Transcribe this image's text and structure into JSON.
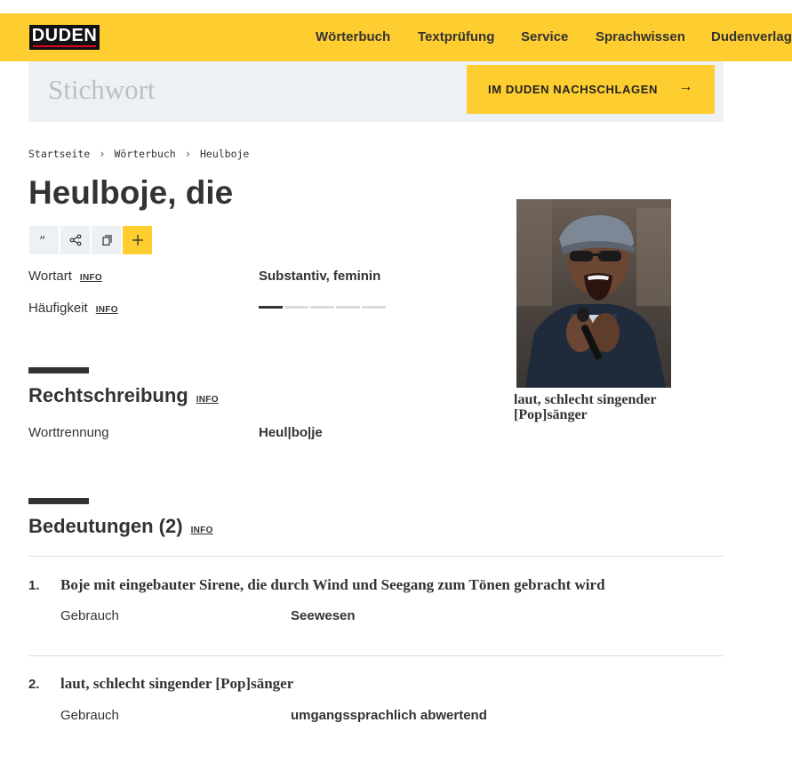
{
  "header": {
    "logo": "DUDEN",
    "nav": [
      "Wörterbuch",
      "Textprüfung",
      "Service",
      "Sprachwissen",
      "Dudenverlag"
    ]
  },
  "search": {
    "placeholder": "Stichwort",
    "button_label": "IM DUDEN NACHSCHLAGEN",
    "button_icon": "arrow-right-icon"
  },
  "breadcrumb": [
    "Startseite",
    "Wörterbuch",
    "Heulboje"
  ],
  "entry": {
    "title": "Heulboje, die",
    "tools": [
      "quote-icon",
      "share-icon",
      "copy-icon",
      "plus-icon"
    ],
    "wortart_label": "Wortart",
    "wortart_value": "Substantiv, feminin",
    "haeufigkeit_label": "Häufigkeit",
    "haeufigkeit_level": 1,
    "haeufigkeit_max": 5,
    "info": "INFO"
  },
  "rechtschreibung": {
    "heading": "Rechtschreibung",
    "worttrennung_label": "Worttrennung",
    "worttrennung_value": "Heul|bo|je"
  },
  "bedeutungen": {
    "heading": "Bedeutungen (2)",
    "items": [
      {
        "num": "1.",
        "text": "Boje mit eingebauter Sirene, die durch Wind und Seegang zum Tönen gebracht wird",
        "gebrauch_label": "Gebrauch",
        "gebrauch_value": "Seewesen"
      },
      {
        "num": "2.",
        "text": "laut, schlecht singender [Pop]sänger",
        "gebrauch_label": "Gebrauch",
        "gebrauch_value": "umgangssprachlich abwertend"
      }
    ]
  },
  "image": {
    "caption": "laut, schlecht singender [Pop]sänger"
  },
  "colors": {
    "brand_yellow": "#fecd30",
    "text": "#333333",
    "search_bg": "#eef1f4"
  }
}
